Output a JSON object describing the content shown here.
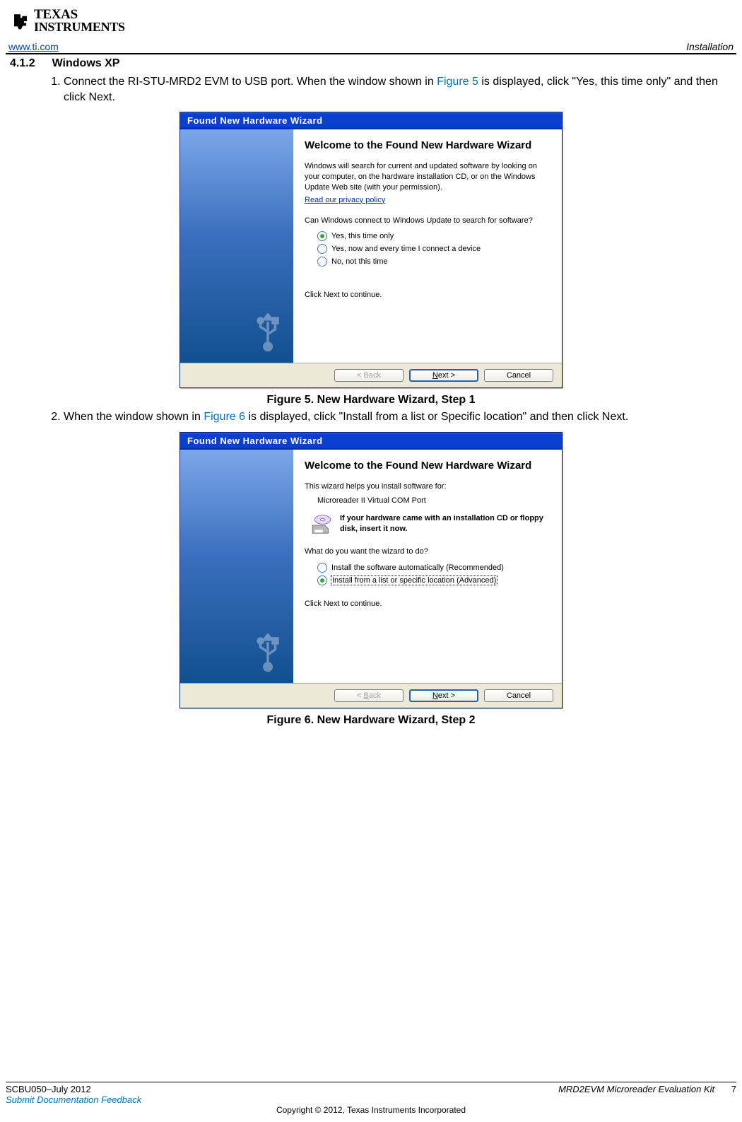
{
  "logo": {
    "line1": "TEXAS",
    "line2": "INSTRUMENTS"
  },
  "header": {
    "site": "www.ti.com",
    "sectionRight": "Installation"
  },
  "section": {
    "number": "4.1.2",
    "title": "Windows XP"
  },
  "steps": {
    "item1_pre": "Connect the RI-STU-MRD2 EVM to USB port. When the window shown in ",
    "item1_ref": "Figure 5",
    "item1_post": " is displayed, click \"Yes, this time only\" and then click Next.",
    "item2_pre": "When the window shown in ",
    "item2_ref": "Figure 6",
    "item2_post": " is displayed, click \"Install from a list or Specific location\" and then click Next."
  },
  "figure1": {
    "caption": "Figure 5. New Hardware Wizard, Step 1",
    "titlebar": "Found New Hardware Wizard",
    "heading": "Welcome to the Found New Hardware Wizard",
    "para": "Windows will search for current and updated software by looking on your computer, on the hardware installation CD, or on the Windows Update Web site (with your permission).",
    "privacy": "Read our privacy policy",
    "question": "Can Windows connect to Windows Update to search for software?",
    "opt1": "Yes, this time only",
    "opt2": "Yes, now and every time I connect a device",
    "opt3": "No, not this time",
    "continue": "Click Next to continue.",
    "btn_back": "< Back",
    "btn_next_pre": "N",
    "btn_next_post": "ext >",
    "btn_cancel": "Cancel"
  },
  "figure2": {
    "caption": "Figure 6. New Hardware Wizard, Step 2",
    "titlebar": "Found New Hardware Wizard",
    "heading": "Welcome to the Found New Hardware Wizard",
    "intro": "This wizard helps you install software for:",
    "device": "Microreader II Virtual COM Port",
    "cdtext": "If your hardware came with an installation CD or floppy disk, insert it now.",
    "question": "What do you want the wizard to do?",
    "opt1_pre": "Install the software automatically (Recommended)",
    "opt2_pre": "Install from a list or specific location (Advanced)",
    "continue": "Click Next to continue.",
    "btn_back_pre": "< ",
    "btn_back_letter": "B",
    "btn_back_post": "ack",
    "btn_next_pre": "N",
    "btn_next_post": "ext >",
    "btn_cancel": "Cancel"
  },
  "footer": {
    "docnum": "SCBU050–July 2012",
    "feedback": "Submit Documentation Feedback",
    "docname": "MRD2EVM Microreader Evaluation Kit",
    "pagenum": "7",
    "copyright": "Copyright © 2012, Texas Instruments Incorporated"
  }
}
